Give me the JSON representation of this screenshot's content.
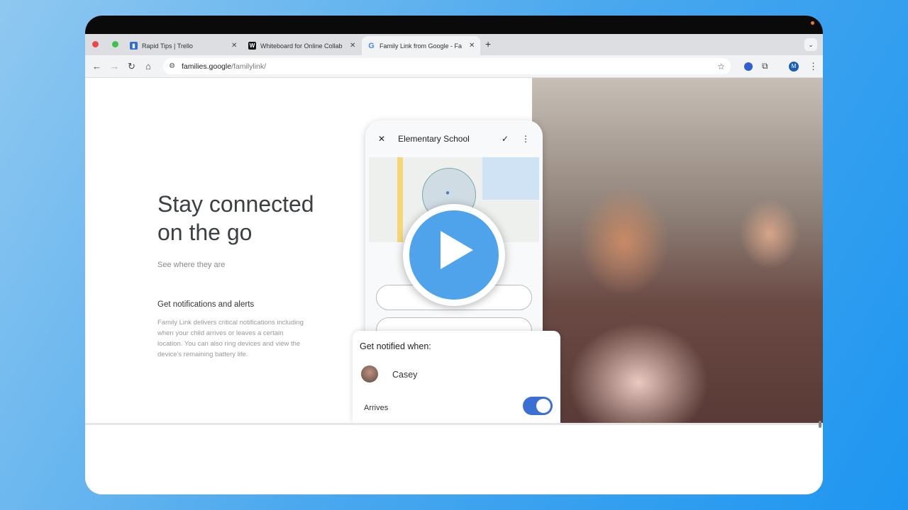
{
  "browser": {
    "tabs": [
      {
        "title": "Rapid Tips | Trello",
        "icon": "trello-icon",
        "color": "#2d6fd6"
      },
      {
        "title": "Whiteboard for Online Collab",
        "icon": "w-logo-icon",
        "color": "#111111"
      },
      {
        "title": "Family Link from Google - Fa",
        "icon": "google-icon",
        "color": "#4285f4",
        "active": true
      }
    ],
    "new_tab": "+",
    "url_host": "families.google",
    "url_path": "/familylink/",
    "profile_initial": "M"
  },
  "hero": {
    "title_line1": "Stay connected",
    "title_line2": "on the go",
    "subtitle": "See where they are"
  },
  "feature": {
    "heading": "Get notifications and alerts",
    "body": "Family Link delivers critical notifications including when your child arrives or leaves a certain location. You can also ring devices and view the device's remaining battery life."
  },
  "phone": {
    "title": "Elementary School"
  },
  "card": {
    "title": "Get notified when:",
    "person": "Casey",
    "option": "Arrives",
    "toggle_on": true
  },
  "colors": {
    "accent": "#4ea3ea",
    "toggle": "#3b6fd3"
  }
}
